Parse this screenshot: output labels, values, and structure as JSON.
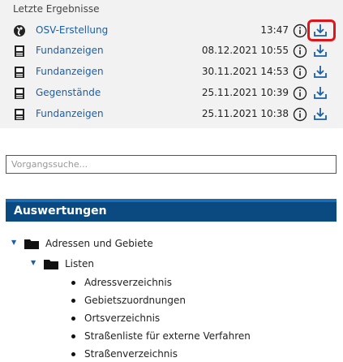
{
  "recent_results": {
    "heading": "Letzte Ergebnisse",
    "items": [
      {
        "label": "OSV-Erstellung",
        "time": "13:47",
        "icon": "osv-globe-icon"
      },
      {
        "label": "Fundanzeigen",
        "time": "08.12.2021 10:55",
        "icon": "document-icon"
      },
      {
        "label": "Fundanzeigen",
        "time": "30.11.2021 14:53",
        "icon": "document-icon"
      },
      {
        "label": "Gegenstände",
        "time": "25.11.2021 10:39",
        "icon": "document-icon"
      },
      {
        "label": "Fundanzeigen",
        "time": "25.11.2021 10:38",
        "icon": "document-icon"
      }
    ]
  },
  "search": {
    "placeholder": "Vorgangssuche..."
  },
  "reports": {
    "title": "Auswertungen",
    "tree": {
      "root_label": "Adressen und Gebiete",
      "child_label": "Listen",
      "leaves": [
        "Adressverzeichnis",
        "Gebietszuordnungen",
        "Ortsverzeichnis",
        "Straßenliste für externe Verfahren",
        "Straßenverzeichnis"
      ]
    }
  },
  "colors": {
    "link": "#1a5fa8",
    "header_bg": "#0b4a80",
    "highlight": "#e0141b",
    "panel_bg": "#f2f2f2"
  }
}
